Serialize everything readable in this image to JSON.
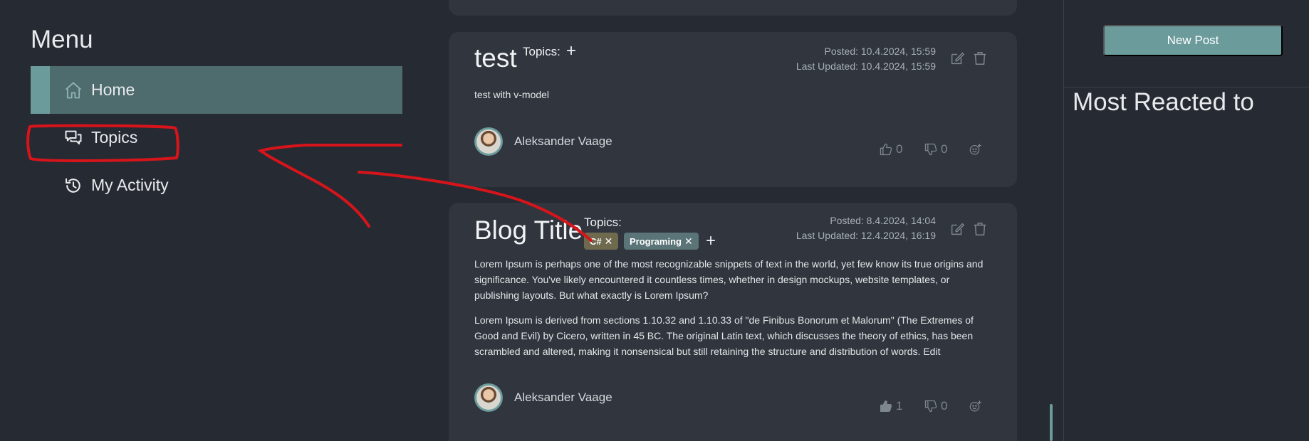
{
  "menu": {
    "title": "Menu",
    "items": [
      {
        "label": "Home",
        "icon": "home-icon"
      },
      {
        "label": "Topics",
        "icon": "chat-bubbles-icon"
      },
      {
        "label": "My Activity",
        "icon": "history-icon"
      }
    ]
  },
  "feed": {
    "posts": [
      {
        "title": "test",
        "topics_label": "Topics:",
        "add_topic": "+",
        "posted": "Posted: 10.4.2024, 15:59",
        "updated": "Last Updated: 10.4.2024, 15:59",
        "body": [
          "test with v-model"
        ],
        "author": "Aleksander Vaage",
        "likes": "0",
        "dislikes": "0",
        "tags": []
      },
      {
        "title": "Blog Title",
        "topics_label": "Topics:",
        "add_topic": "+",
        "posted": "Posted: 8.4.2024, 14:04",
        "updated": "Last Updated: 12.4.2024, 16:19",
        "tags": [
          {
            "label": "C#",
            "remove": "✕",
            "color": "#6f6a4e"
          },
          {
            "label": "Programing",
            "remove": "✕",
            "color": "#5a7478"
          }
        ],
        "body": [
          "Lorem Ipsum is perhaps one of the most recognizable snippets of text in the world, yet few know its true origins and significance. You've likely encountered it countless times, whether in design mockups, website templates, or publishing layouts. But what exactly is Lorem Ipsum?",
          "Lorem Ipsum is derived from sections 1.10.32 and 1.10.33 of \"de Finibus Bonorum et Malorum\" (The Extremes of Good and Evil) by Cicero, written in 45 BC. The original Latin text, which discusses the theory of ethics, has been scrambled and altered, making it nonsensical but still retaining the structure and distribution of words. Edit"
        ],
        "author": "Aleksander Vaage",
        "likes": "1",
        "dislikes": "0"
      }
    ]
  },
  "sidebar_right": {
    "new_post_label": "New Post",
    "most_reacted_title": "Most Reacted to"
  },
  "colors": {
    "background": "#262a33",
    "card": "#30353e",
    "accent": "#6c9b9c",
    "active_menu": "#4e6b6d",
    "annotation": "#d8141b"
  }
}
